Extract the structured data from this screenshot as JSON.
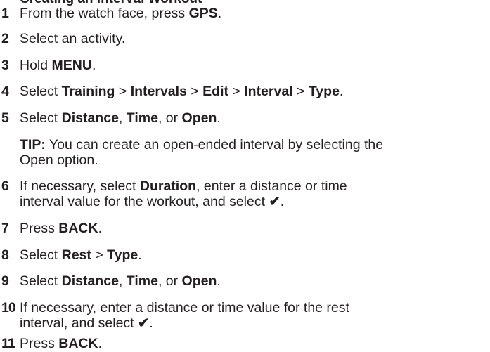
{
  "heading": "Creating an Interval Workout",
  "check_icon": "checkmark-icon",
  "steps": [
    {
      "num": "1",
      "t1": "From the watch face, press ",
      "b1": "GPS",
      "t2": "."
    },
    {
      "num": "2",
      "t1": "Select an activity."
    },
    {
      "num": "3",
      "t1": "Hold ",
      "b1": "MENU",
      "t2": "."
    },
    {
      "num": "4",
      "t1": "Select ",
      "b1": "Training",
      "t2": " > ",
      "b2": "Intervals",
      "t3": " > ",
      "b3": "Edit",
      "t4": " > ",
      "b4": "Interval",
      "t5": " > ",
      "b5": "Type",
      "t6": "."
    },
    {
      "num": "5",
      "t1": "Select ",
      "b1": "Distance",
      "t2": ", ",
      "b2": "Time",
      "t3": ", or ",
      "b3": "Open",
      "t4": "."
    },
    {
      "num": "6",
      "t1": "If necessary, select ",
      "b1": "Duration",
      "t2": ", enter a distance or time",
      "t3": "interval value for the workout, and select ",
      "t4": "."
    },
    {
      "num": "7",
      "t1": "Press ",
      "b1": "BACK",
      "t2": "."
    },
    {
      "num": "8",
      "t1": "Select ",
      "b1": "Rest",
      "t2": " > ",
      "b2": "Type",
      "t3": "."
    },
    {
      "num": "9",
      "t1": "Select ",
      "b1": "Distance",
      "t2": ", ",
      "b2": "Time",
      "t3": ", or ",
      "b3": "Open",
      "t4": "."
    },
    {
      "num": "10",
      "t1": "If necessary, enter a distance or time value for the rest",
      "t2": "interval, and select ",
      "t3": "."
    },
    {
      "num": "11",
      "t1": "Press ",
      "b1": "BACK",
      "t2": "."
    }
  ],
  "tip": {
    "label": "TIP:",
    "line1": " You can create an open-ended interval by selecting the",
    "line2": "Open option."
  }
}
